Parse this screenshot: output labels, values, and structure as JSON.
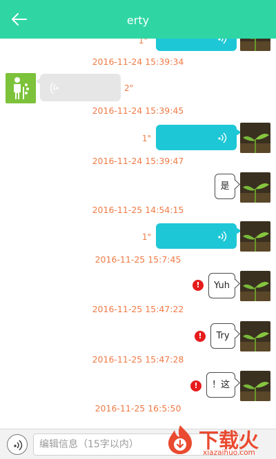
{
  "header": {
    "title": "erty",
    "back_icon": "arrow-left-icon",
    "background": "#2fd6a3"
  },
  "messages": [
    {
      "type": "voice",
      "side": "sent",
      "duration": "1\"",
      "timestamp": "2016-11-24 15:39:34"
    },
    {
      "type": "voice",
      "side": "received",
      "duration": "2\"",
      "timestamp": "2016-11-24 15:39:45"
    },
    {
      "type": "voice",
      "side": "sent",
      "duration": "1\"",
      "timestamp": "2016-11-24 15:39:47"
    },
    {
      "type": "text",
      "side": "sent",
      "text": "是",
      "timestamp": "2016-11-25 14:54:15"
    },
    {
      "type": "voice",
      "side": "sent",
      "duration": "1\"",
      "timestamp": "2016-11-25 15:7:45"
    },
    {
      "type": "text",
      "side": "sent",
      "text": "Yuh",
      "failed": true,
      "timestamp": "2016-11-25 15:47:22"
    },
    {
      "type": "text",
      "side": "sent",
      "text": "Try",
      "failed": true,
      "timestamp": "2016-11-25 15:47:28"
    },
    {
      "type": "text",
      "side": "sent",
      "text": "！这",
      "failed": true,
      "timestamp": "2016-11-25 16:5:50"
    }
  ],
  "input_bar": {
    "placeholder": "编辑信息（15字以内）",
    "value": "",
    "voice_icon": "voice-wave-icon"
  },
  "watermark": {
    "name": "下载火",
    "url": "xiazaihuo.com"
  },
  "colors": {
    "accent": "#2fd6a3",
    "sent_voice_bubble": "#1ec7d6",
    "timestamp": "#ee7a45",
    "error": "#e61c1c"
  }
}
